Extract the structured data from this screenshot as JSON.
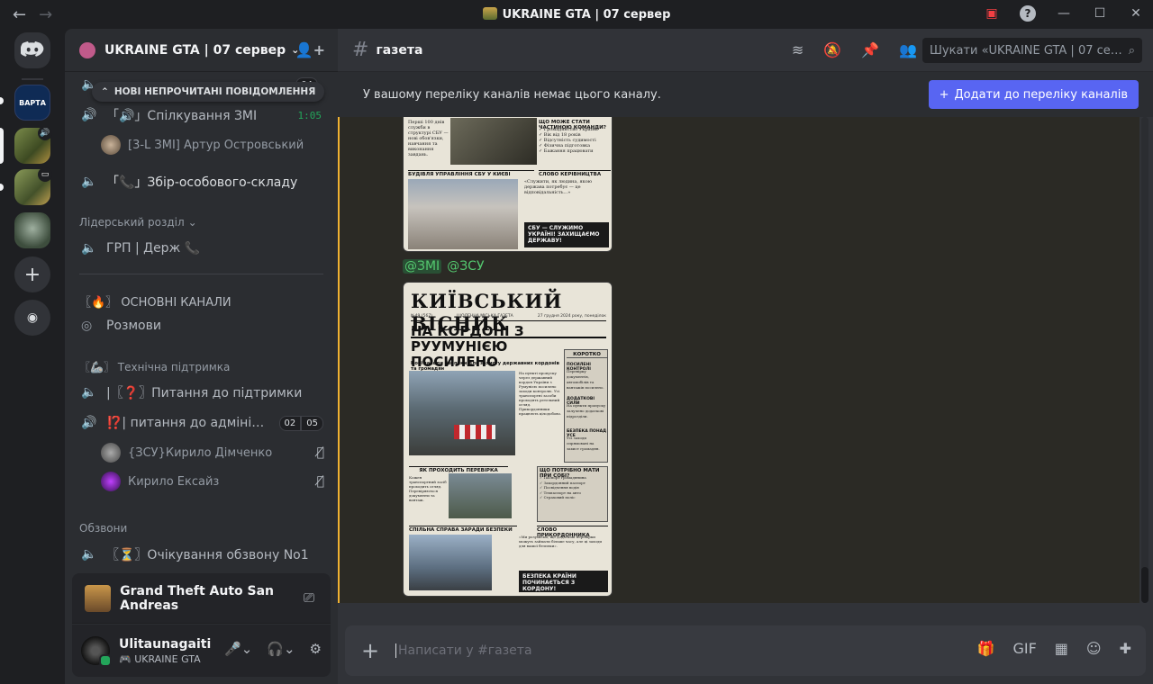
{
  "window": {
    "title": "UKRAINE GTA | 07 сервер",
    "nav_back": "←",
    "nav_forward": "→"
  },
  "titlebar_icons": {
    "inbox": "▣",
    "help": "?",
    "minimize": "—",
    "maximize": "☐",
    "close": "✕"
  },
  "server_list": {
    "s1_label": "ВАРТА",
    "add_label": "+",
    "discover_label": "◉"
  },
  "guild": {
    "name": "UKRAINE GTA | 07 сервер"
  },
  "sidebar": {
    "new_unread": "НОВІ НЕПРОЧИТАНІ ПОВІДОМЛЕННЯ",
    "hidden_top_badge": "04",
    "voice_zmi": {
      "label": "「🔊」Спілкування ЗМІ",
      "timer": "1:05"
    },
    "voice_zmi_user": "[3-L ЗМІ] Артур Островський",
    "voice_zbir": {
      "label": "「📞」Збір-особового-складу"
    },
    "cat_leader": "Лідерський розділ",
    "ch_grp": "ГРП | Держ 📞",
    "cat_main": "〖🔥〗 ОСНОВНІ КАНАЛИ",
    "ch_rozmovy": "Розмови",
    "cat_support": "〖🦾〗 Технічна підтримка",
    "ch_support": "|〖❓〗Питання до підтримки",
    "ch_admin": {
      "label": "⁉️| питання до адміні…",
      "badge_a": "02",
      "badge_b": "05"
    },
    "admin_users": [
      "{ЗСУ}Кирило Дімченко",
      "Кирило Ексайз"
    ],
    "cat_obzvony": "Обзвони",
    "ch_obzvon": "〖⏳〗Очікування обзвону No1"
  },
  "activity": {
    "game": "Grand Theft Auto San Andreas"
  },
  "user": {
    "name": "Ulitaunagaiti",
    "status": "UKRAINE GTA"
  },
  "channel": {
    "name": "газета"
  },
  "search": {
    "placeholder": "Шукати «UKRAINE GTA | 07 сер…"
  },
  "notice": {
    "text": "У вашому переліку каналів немає цього каналу.",
    "button": "Додати до переліку каналів"
  },
  "message": {
    "mentions": [
      "@ЗМІ",
      "@ЗСУ"
    ]
  },
  "paper1": {
    "h_right": "ЩО МОЖЕ СТАТИ ЧАСТИНОЮ КОМАНДИ?",
    "h_left2": "БУДІВЛЯ УПРАВЛІННЯ СБУ У КИЄВІ",
    "h_right2": "СЛОВО КЕРІВНИЦТВА",
    "slogan": "СБУ — СЛУЖИМО УКРАЇНІ! ЗАХИЩАЄМО ДЕРЖАВУ!"
  },
  "paper2": {
    "masthead": "КИЇВСЬКИЙ ВІСНИК",
    "issue": "№49 (567)",
    "tagline": "ЩОДЕННА МІСЬКА ГАЗЕТА",
    "date": "27 грудня 2024 року, понеділок",
    "headline": "НА КОРДОНІ З РУУМУНІЄЮ ПОСИЛЕНО КОНТРОЛЬ",
    "deck": "Нові заходи безпеки для захисту державних кордонів та громадян",
    "side_title": "КОРОТКО",
    "side_1": "ПОСИЛЕНІ КОНТРОЛІ",
    "side_2": "ДОДАТКОВІ СИЛИ",
    "side_3": "БЕЗПЕКА ПОНАД УСЕ",
    "sec_check": "ЯК ПРОХОДИТЬ ПЕРЕВІРКА",
    "sec_need": "ЩО ПОТРІБНО МАТИ ПРИ СОБІ?",
    "sec_joint": "СПІЛЬНА СПРАВА ЗАРАДИ БЕЗПЕКИ",
    "sec_word": "СЛОВО ПРИКОРДОННИКА",
    "slogan": "БЕЗПЕКА КРАЇНИ ПОЧИНАЄТЬСЯ З КОРДОНУ!"
  },
  "composer": {
    "placeholder": "Написати у #газета",
    "plus": "+"
  }
}
